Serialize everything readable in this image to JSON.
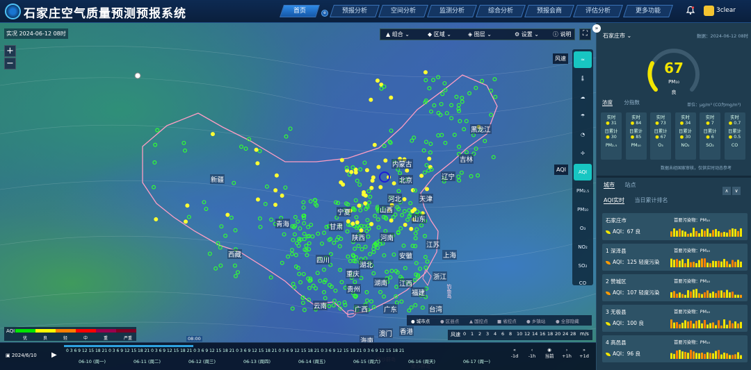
{
  "header": {
    "title": "石家庄空气质量预测预报系统",
    "nav": [
      "首页",
      "预报分析",
      "空间分析",
      "监测分析",
      "综合分析",
      "预报会商",
      "评估分析",
      "更多功能"
    ],
    "nav_badge": "e",
    "user": "3clear"
  },
  "map": {
    "realtime": "实况 2024-06-12 08时",
    "zoom_in": "+",
    "zoom_out": "−",
    "toolbar": [
      "组合",
      "区域",
      "图层",
      "设置",
      "说明"
    ],
    "fullscreen": "⛶",
    "collapse": "»",
    "wind_button": "风速",
    "right_buttons": [
      "AQI",
      "PM₂.₅",
      "PM₁₀",
      "O₃",
      "NO₂",
      "SO₂",
      "CO"
    ],
    "aqi_tag": "AQI",
    "labels": [
      {
        "t": "黑龙江"
      },
      {
        "t": "吉林"
      },
      {
        "t": "内蒙古"
      },
      {
        "t": "辽宁"
      },
      {
        "t": "北京"
      },
      {
        "t": "河北"
      },
      {
        "t": "天津"
      },
      {
        "t": "新疆"
      },
      {
        "t": "宁夏"
      },
      {
        "t": "山西"
      },
      {
        "t": "山东"
      },
      {
        "t": "青海"
      },
      {
        "t": "甘肃"
      },
      {
        "t": "陕西"
      },
      {
        "t": "河南"
      },
      {
        "t": "江苏"
      },
      {
        "t": "西藏"
      },
      {
        "t": "四川"
      },
      {
        "t": "湖北"
      },
      {
        "t": "安徽"
      },
      {
        "t": "上海"
      },
      {
        "t": "重庆"
      },
      {
        "t": "浙江"
      },
      {
        "t": "湖南"
      },
      {
        "t": "江西"
      },
      {
        "t": "贵州"
      },
      {
        "t": "福建"
      },
      {
        "t": "台湾"
      },
      {
        "t": "云南"
      },
      {
        "t": "广西"
      },
      {
        "t": "广东"
      },
      {
        "t": "香港"
      },
      {
        "t": "澳门"
      },
      {
        "t": "海南"
      },
      {
        "t": "钓鱼岛"
      },
      {
        "t": "西沙群岛"
      },
      {
        "t": "南沙群岛"
      }
    ]
  },
  "legend": {
    "title": "AQI",
    "levels": [
      "优",
      "良",
      "轻",
      "中",
      "重",
      "严重"
    ],
    "colors": [
      "#00e400",
      "#ffff00",
      "#ff7e00",
      "#ff0000",
      "#99004c",
      "#7e0023"
    ]
  },
  "layers": [
    "城市点",
    "区县点",
    "国控点",
    "省控点",
    "乡镇站",
    "全部隐藏"
  ],
  "wind": {
    "title": "风速",
    "ticks": [
      "0",
      "1",
      "2",
      "3",
      "4",
      "6",
      "8",
      "10",
      "12",
      "14",
      "16",
      "18",
      "20",
      "24",
      "28"
    ],
    "unit": "m/s"
  },
  "timeline": {
    "date": "2024/6/10",
    "current": "08:00",
    "hours": "0 3 6 9 12 15 18 21",
    "days": [
      "06-10 (周一)",
      "06-11 (周二)",
      "06-12 (周三)",
      "06-13 (周四)",
      "06-14 (周五)",
      "06-15 (周六)",
      "06-16 (周天)",
      "06-17 (周一)"
    ],
    "controls": [
      {
        "i": "«",
        "t": "-1d"
      },
      {
        "i": "‹",
        "t": "-1h"
      },
      {
        "i": "◉",
        "t": "当前"
      },
      {
        "i": "›",
        "t": "+1h"
      },
      {
        "i": "»",
        "t": "+1d"
      }
    ]
  },
  "panel": {
    "city": "石家庄市",
    "date": "数据：2024-06-12 08时",
    "aqi": {
      "value": "67",
      "pollutant": "PM₁₀",
      "level": "良"
    },
    "tabs": [
      "浓度",
      "分指数"
    ],
    "unit": "单位：μg/m³ (CO为mg/m³)",
    "cards": [
      {
        "label": "实时",
        "rt": "31",
        "day_label": "日累计",
        "day": "30",
        "name": "PM₂.₅"
      },
      {
        "label": "实时",
        "rt": "84",
        "day_label": "日累计",
        "day": "85",
        "name": "PM₁₀"
      },
      {
        "label": "实时",
        "rt": "73",
        "day_label": "日累计",
        "day": "67",
        "name": "O₃"
      },
      {
        "label": "实时",
        "rt": "34",
        "day_label": "日累计",
        "day": "30",
        "name": "NO₂"
      },
      {
        "label": "实时",
        "rt": "7",
        "day_label": "日累计",
        "day": "6",
        "name": "SO₂"
      },
      {
        "label": "实时",
        "rt": "0.7",
        "day_label": "日累计",
        "day": "0.5",
        "name": "CO"
      }
    ],
    "note": "数据未经国家审核，仅供实时动态参考",
    "tabs2": [
      "城市",
      "站点"
    ],
    "tabs3": [
      "AQI实时",
      "当日累计排名"
    ],
    "rank_btns": [
      "∧",
      "∨"
    ],
    "rows": [
      {
        "name": "石家庄市",
        "primary": "首要污染物：PM₁₀",
        "aqi": "AQI：67 良",
        "color": "#f2e500"
      },
      {
        "name": "1 深泽县",
        "primary": "首要污染物：PM₁₀",
        "aqi": "AQI：125 轻度污染",
        "color": "#ff9a00"
      },
      {
        "name": "2 赞城区",
        "primary": "首要污染物：PM₁₀",
        "aqi": "AQI：107 轻度污染",
        "color": "#ff9a00"
      },
      {
        "name": "3 无极县",
        "primary": "首要污染物：PM₁₀",
        "aqi": "AQI：100 良",
        "color": "#f2e500"
      },
      {
        "name": "4 高邑县",
        "primary": "首要污染物：PM₁₀",
        "aqi": "AQI：96 良",
        "color": "#f2e500"
      }
    ]
  }
}
